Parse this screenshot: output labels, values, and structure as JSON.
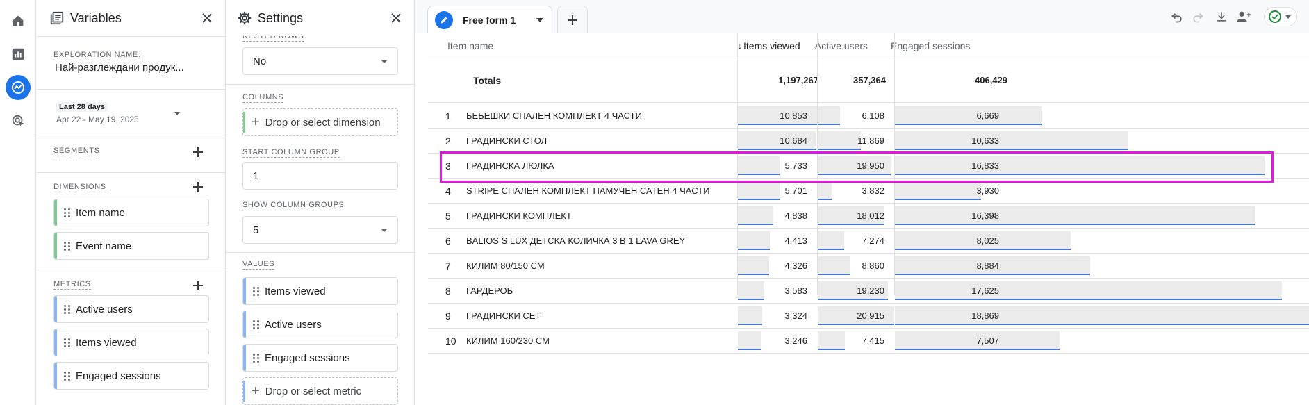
{
  "rail": {
    "items": [
      "home-icon",
      "reports-icon",
      "explore-icon",
      "advertising-icon"
    ],
    "active": "explore-icon"
  },
  "variables": {
    "title": "Variables",
    "exploration_label": "EXPLORATION NAME:",
    "exploration_name": "Най-разглеждани продук...",
    "date_range_label": "Last 28 days",
    "date_range_value": "Apr 22 - May 19, 2025",
    "segments_label": "SEGMENTS",
    "dimensions_label": "DIMENSIONS",
    "dimensions": [
      "Item name",
      "Event name"
    ],
    "metrics_label": "METRICS",
    "metrics": [
      "Active users",
      "Items viewed",
      "Engaged sessions"
    ],
    "colors": {
      "dimension": "#81c995",
      "metric": "#8ab4f8"
    }
  },
  "settings": {
    "title": "Settings",
    "nested_rows_label": "NESTED ROWS",
    "nested_rows_value": "No",
    "columns_label": "COLUMNS",
    "columns_drop": "Drop or select dimension",
    "start_col_label": "START COLUMN GROUP",
    "start_col_value": "1",
    "show_groups_label": "SHOW COLUMN GROUPS",
    "show_groups_value": "5",
    "values_label": "VALUES",
    "values": [
      "Items viewed",
      "Active users",
      "Engaged sessions"
    ],
    "values_drop": "Drop or select metric"
  },
  "canvas": {
    "tab_label": "Free form 1",
    "accent": "#1a73e8",
    "highlight_color": "#e516e5",
    "columns": {
      "item": "Item name",
      "viewed": "Items viewed",
      "active": "Active users",
      "engaged": "Engaged sessions"
    },
    "totals": {
      "label": "Totals",
      "viewed": "1,197,267",
      "active": "357,364",
      "engaged": "406,429"
    },
    "rows": [
      {
        "n": "1",
        "name": "БЕБЕШКИ СПАЛЕН КОМПЛЕКТ 4 ЧАСТИ",
        "viewed": "10,853",
        "active": "6,108",
        "engaged": "6,669"
      },
      {
        "n": "2",
        "name": "ГРАДИНСКИ СТОЛ",
        "viewed": "10,684",
        "active": "11,869",
        "engaged": "10,633"
      },
      {
        "n": "3",
        "name": "ГРАДИНСКА ЛЮЛКА",
        "viewed": "5,733",
        "active": "19,950",
        "engaged": "16,833"
      },
      {
        "n": "4",
        "name": "STRIPE СПАЛЕН КОМПЛЕКТ ПАМУЧЕН САТЕН 4 ЧАСТИ",
        "viewed": "5,701",
        "active": "3,832",
        "engaged": "3,930"
      },
      {
        "n": "5",
        "name": "ГРАДИНСКИ КОМПЛЕКТ",
        "viewed": "4,838",
        "active": "18,012",
        "engaged": "16,398"
      },
      {
        "n": "6",
        "name": "BALIOS S LUX ДЕТСКА КОЛИЧКА 3 В 1 LAVA GREY",
        "viewed": "4,413",
        "active": "7,274",
        "engaged": "8,025"
      },
      {
        "n": "7",
        "name": "КИЛИМ 80/150 СМ",
        "viewed": "4,326",
        "active": "8,860",
        "engaged": "8,884"
      },
      {
        "n": "8",
        "name": "ГАРДЕРОБ",
        "viewed": "3,583",
        "active": "19,230",
        "engaged": "17,625"
      },
      {
        "n": "9",
        "name": "ГРАДИНСКИ СЕТ",
        "viewed": "3,324",
        "active": "20,915",
        "engaged": "18,869"
      },
      {
        "n": "10",
        "name": "КИЛИМ 160/230 СМ",
        "viewed": "3,246",
        "active": "7,415",
        "engaged": "7,507"
      }
    ]
  }
}
